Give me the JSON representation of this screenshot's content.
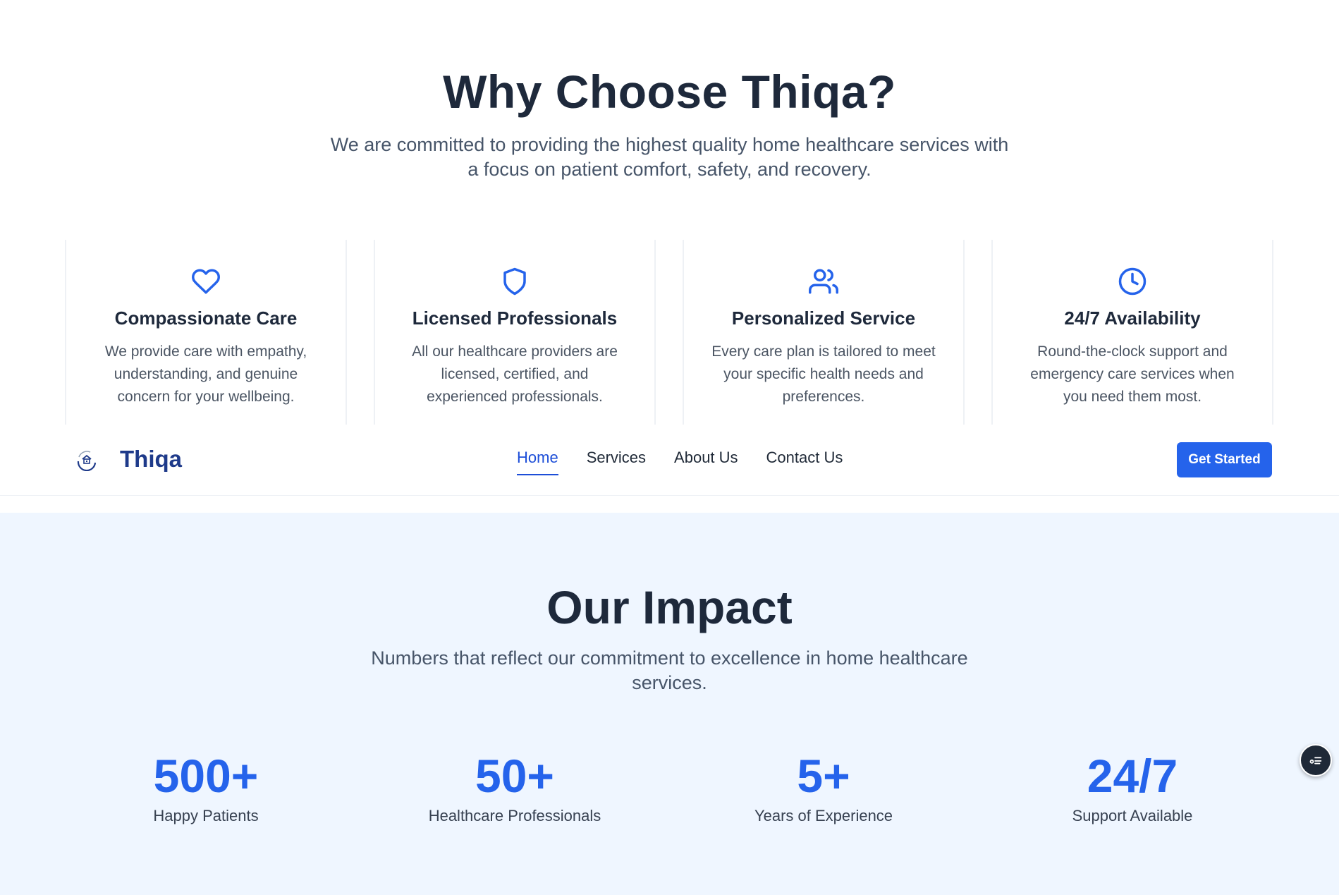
{
  "why": {
    "title": "Why Choose Thiqa?",
    "subtitle": "We are committed to providing the highest quality home healthcare services with a focus on patient comfort, safety, and recovery.",
    "features": [
      {
        "icon": "heart-icon",
        "title": "Compassionate Care",
        "description": "We provide care with empathy, understanding, and genuine concern for your wellbeing."
      },
      {
        "icon": "shield-icon",
        "title": "Licensed Professionals",
        "description": "All our healthcare providers are licensed, certified, and experienced professionals."
      },
      {
        "icon": "users-icon",
        "title": "Personalized Service",
        "description": "Every care plan is tailored to meet your specific health needs and preferences."
      },
      {
        "icon": "clock-icon",
        "title": "24/7 Availability",
        "description": "Round-the-clock support and emergency care services when you need them most."
      }
    ]
  },
  "nav": {
    "brand": "Thiqa",
    "links": [
      "Home",
      "Services",
      "About Us",
      "Contact Us"
    ],
    "active_link": "Home",
    "cta": "Get Started"
  },
  "impact": {
    "title": "Our Impact",
    "subtitle": "Numbers that reflect our commitment to excellence in home healthcare services.",
    "stats": [
      {
        "value": "500+",
        "label": "Happy Patients"
      },
      {
        "value": "50+",
        "label": "Healthcare Professionals"
      },
      {
        "value": "5+",
        "label": "Years of Experience"
      },
      {
        "value": "24/7",
        "label": "Support Available"
      }
    ]
  },
  "colors": {
    "accent": "#2563eb",
    "heading": "#1e293b",
    "impact_bg": "#eff6ff"
  }
}
